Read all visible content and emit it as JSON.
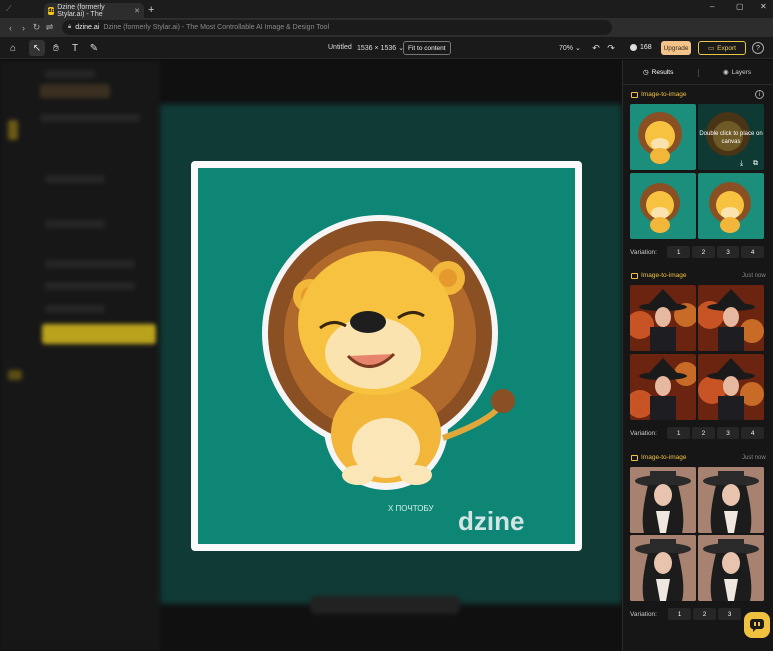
{
  "browser": {
    "tab_title": "Dzine (formerly Stylar.ai) - The",
    "tab_favicon": "dz",
    "new_tab": "+",
    "url_host": "dzine.ai",
    "url_rest": "Dzine (formerly Stylar.ai) - The Most Controllable AI Image & Design Tool",
    "window_controls": [
      "–",
      "▢",
      "✕"
    ]
  },
  "toolbar": {
    "doc_title": "Untitled",
    "canvas_size": "1536 × 1536",
    "fit_label": "Fit to content",
    "zoom": "70%",
    "credits": "168",
    "upgrade_label": "Upgrade",
    "export_label": "Export",
    "help_label": "?"
  },
  "panel": {
    "tabs": [
      {
        "label": "Results",
        "icon": "history-icon",
        "active": true
      },
      {
        "label": "Layers",
        "icon": "eye-icon",
        "active": false
      }
    ],
    "cards": [
      {
        "title": "Image-to-image",
        "time": "",
        "overlay": "Double click to place on canvas",
        "variation_label": "Variation:",
        "variations": [
          "1",
          "2",
          "3",
          "4"
        ]
      },
      {
        "title": "Image-to-image",
        "time": "Just now",
        "variation_label": "Variation:",
        "variations": [
          "1",
          "2",
          "3",
          "4"
        ]
      },
      {
        "title": "Image-to-image",
        "time": "Just now",
        "variation_label": "Variation:",
        "variations": [
          "1",
          "2",
          "3"
        ]
      }
    ]
  },
  "artwork": {
    "watermark": "dzine",
    "signature": "X ПОЧТОБУ"
  },
  "colors": {
    "accent": "#f0c040",
    "artboard_bg": "#0e8676",
    "upgrade_bg": "#f4c38a"
  }
}
